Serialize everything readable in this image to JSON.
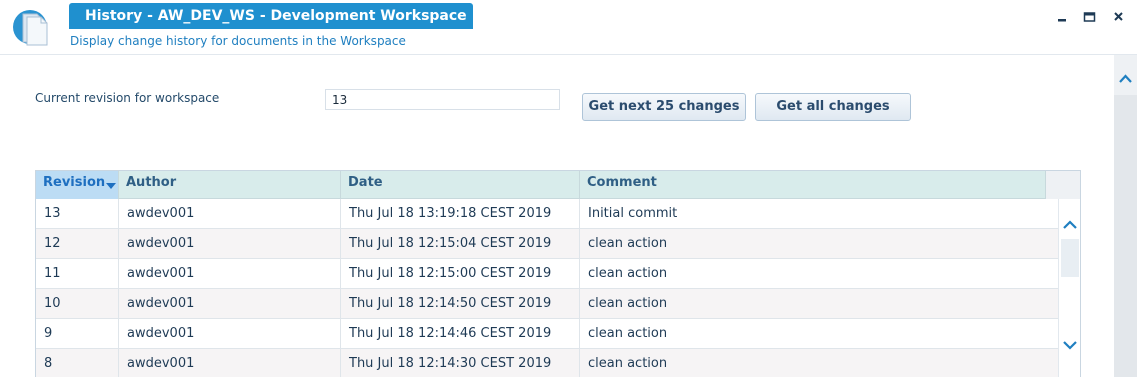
{
  "window": {
    "title": "History - AW_DEV_WS - Development Workspace",
    "subtitle": "Display change history for documents in the Workspace"
  },
  "form": {
    "revision_label": "Current revision for workspace",
    "revision_value": "13",
    "next_button": "Get next 25 changes",
    "all_button": "Get all changes"
  },
  "table": {
    "columns": [
      "Revision",
      "Author",
      "Date",
      "Comment"
    ],
    "sorted_column": "Revision",
    "rows": [
      {
        "revision": "13",
        "author": "awdev001",
        "date": "Thu Jul 18 13:19:18 CEST 2019",
        "comment": "Initial commit"
      },
      {
        "revision": "12",
        "author": "awdev001",
        "date": "Thu Jul 18 12:15:04 CEST 2019",
        "comment": "clean action"
      },
      {
        "revision": "11",
        "author": "awdev001",
        "date": "Thu Jul 18 12:15:00 CEST 2019",
        "comment": "clean action"
      },
      {
        "revision": "10",
        "author": "awdev001",
        "date": "Thu Jul 18 12:14:50 CEST 2019",
        "comment": "clean action"
      },
      {
        "revision": "9",
        "author": "awdev001",
        "date": "Thu Jul 18 12:14:46 CEST 2019",
        "comment": "clean action"
      },
      {
        "revision": "8",
        "author": "awdev001",
        "date": "Thu Jul 18 12:14:30 CEST 2019",
        "comment": "clean action"
      }
    ]
  },
  "icons": {
    "app": "document-stack-icon",
    "minimize": "minimize-icon",
    "maximize": "maximize-icon",
    "close": "close-icon",
    "sort": "sort-descending-icon",
    "scroll_up": "chevron-up-icon",
    "scroll_down": "chevron-down-icon"
  },
  "colors": {
    "accent": "#1f90cf",
    "header_row": "#d8eceb",
    "sorted_header": "#bcdcf4",
    "text": "#1e3a55"
  }
}
